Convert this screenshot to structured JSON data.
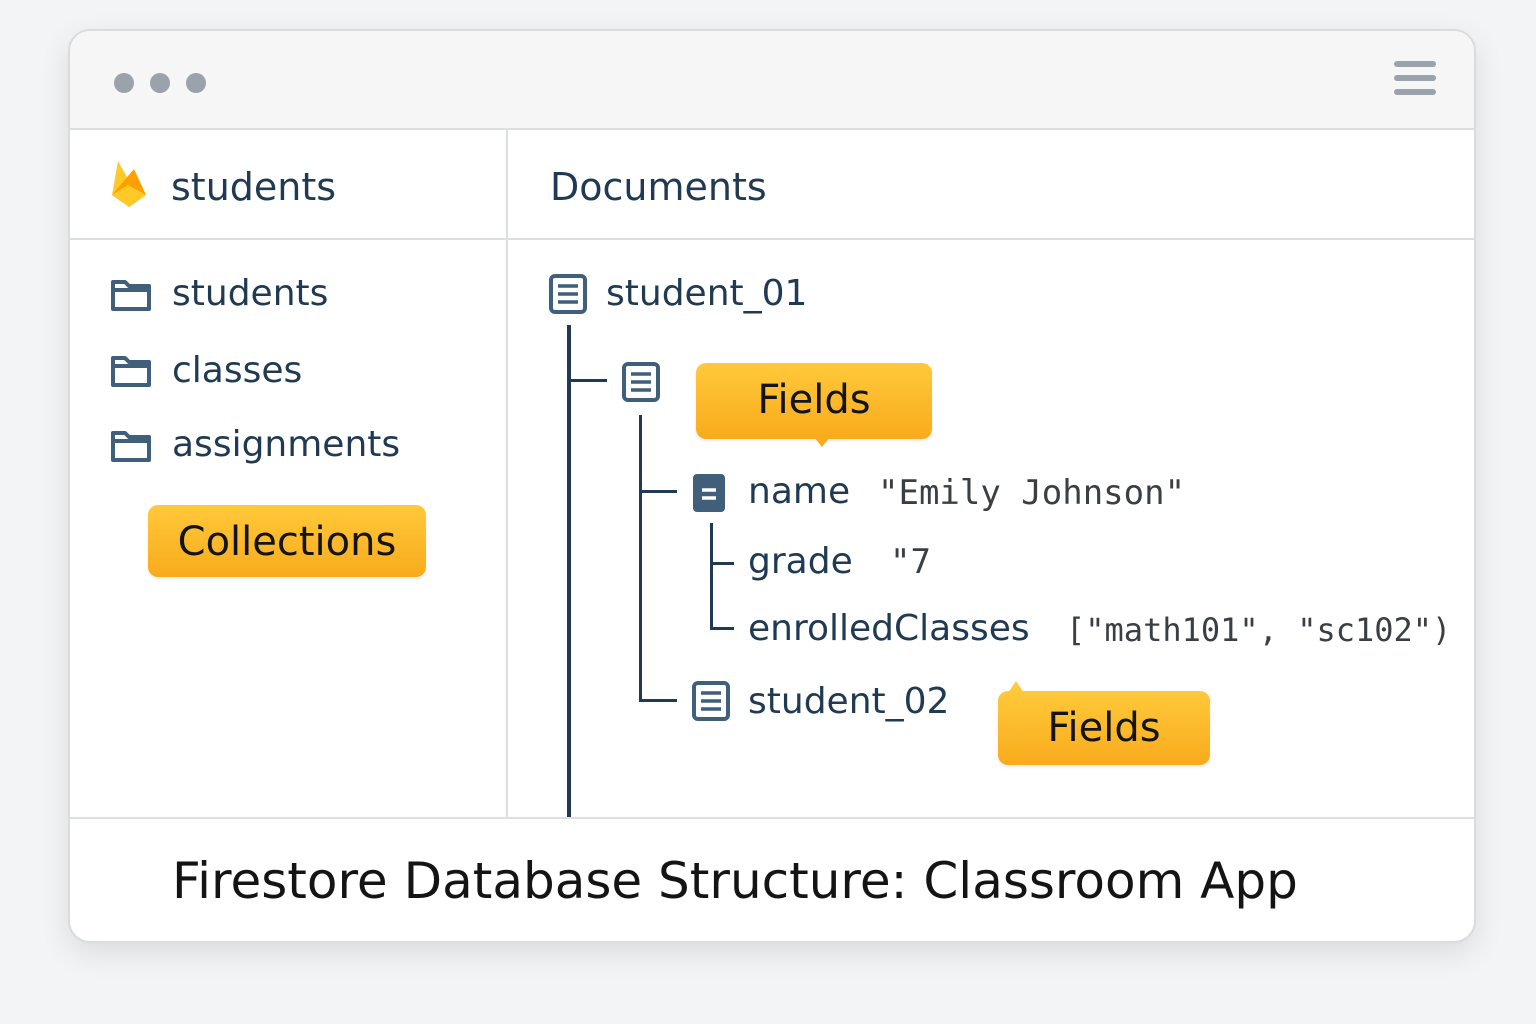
{
  "sidebar": {
    "header": "students",
    "items": [
      {
        "label": "students",
        "icon": "folder-icon"
      },
      {
        "label": "classes",
        "icon": "folder-icon"
      },
      {
        "label": "assignments",
        "icon": "folder-icon"
      }
    ],
    "callout": "Collections"
  },
  "main": {
    "header": "Documents",
    "document": "student_01",
    "callout_fields_1": "Fields",
    "fields": [
      {
        "key": "name",
        "value": "\"Emily  Johnson\""
      },
      {
        "key": "grade",
        "value": "\"7"
      },
      {
        "key": "enrolledClasses",
        "value": "[\"math101\", \"sc102\")"
      }
    ],
    "document_2": "student_02",
    "callout_fields_2": "Fields"
  },
  "footer": {
    "title": "Firestore Database Structure: Classroom App"
  },
  "colors": {
    "accent": "#f8ab1c",
    "text": "#1f3a52",
    "icon": "#3f5f7a"
  }
}
